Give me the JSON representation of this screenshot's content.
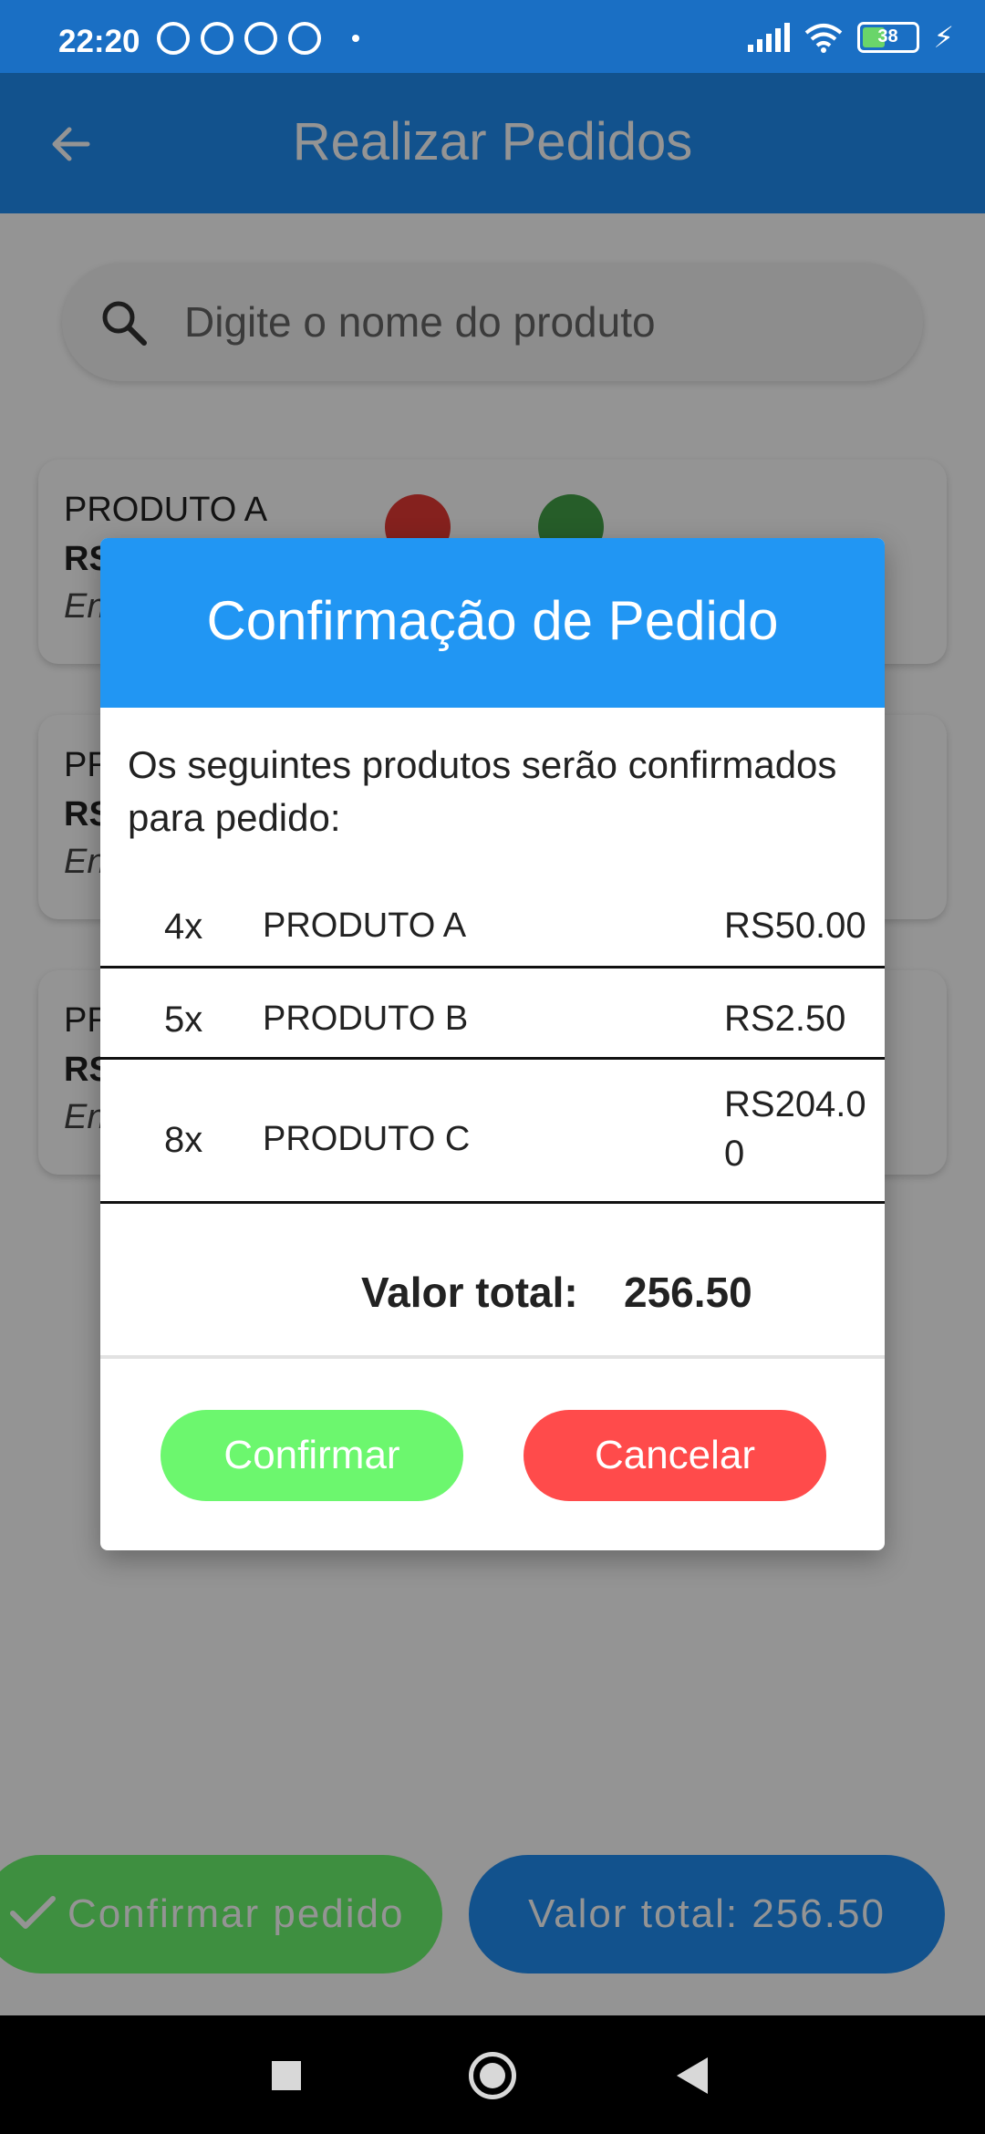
{
  "status_bar": {
    "time": "22:20",
    "battery_level": "38",
    "left_icons": [
      "alarm-icon",
      "whatsapp-icon",
      "app-icon",
      "app-icon",
      "dot-icon"
    ],
    "right_icons": [
      "signal-icon",
      "wifi-icon",
      "battery-icon",
      "charging-icon"
    ]
  },
  "app_bar": {
    "title": "Realizar Pedidos",
    "back_icon": "arrow-back-icon"
  },
  "search": {
    "placeholder": "Digite o nome do produto",
    "value": ""
  },
  "products": [
    {
      "name": "PRODUTO A",
      "price": "RS",
      "stock": "En"
    },
    {
      "name": "PR",
      "price": "RS",
      "stock": "En"
    },
    {
      "name": "PR",
      "price": "RS",
      "stock": "En"
    }
  ],
  "bottom_bar": {
    "confirm_label": "Confirmar pedido",
    "total_label": "Valor total: 256.50"
  },
  "dialog": {
    "title": "Confirmação de Pedido",
    "message": "Os seguintes produtos serão confirmados para pedido:",
    "items": [
      {
        "qty": "4x",
        "name": "PRODUTO A",
        "value": "RS50.00"
      },
      {
        "qty": "5x",
        "name": "PRODUTO B",
        "value": "RS2.50"
      },
      {
        "qty": "8x",
        "name": "PRODUTO C",
        "value": "RS204.00"
      }
    ],
    "total_label": "Valor total:",
    "total_value": "256.50",
    "confirm_label": "Confirmar",
    "cancel_label": "Cancelar"
  },
  "colors": {
    "primary": "#1f8df3",
    "dialog_header": "#2196f3",
    "confirm": "#6cf76e",
    "cancel": "#ff4b4b",
    "minus_button": "#e53935",
    "plus_button": "#43a047"
  }
}
